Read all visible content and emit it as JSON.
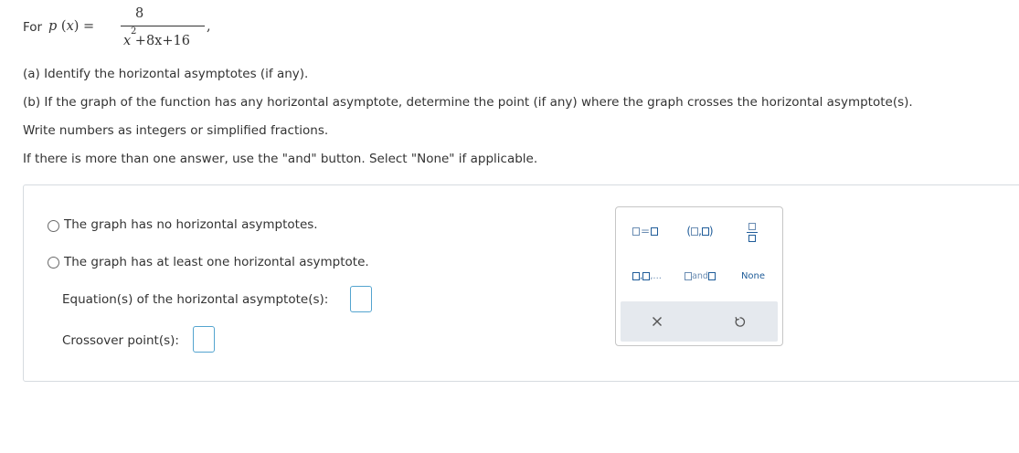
{
  "problem": {
    "lead": "For",
    "function_name": "p",
    "variable": "x",
    "numerator": "8",
    "denominator_rest": " +8x+16",
    "denominator_var": "x",
    "denominator_exp": "2",
    "trailing": ","
  },
  "instructions": {
    "part_a": "(a) Identify the horizontal asymptotes (if any).",
    "part_b": "(b) If the graph of the function has any horizontal asymptote, determine the point (if any) where the graph crosses the horizontal asymptote(s).",
    "format_note": "Write numbers as integers or simplified fractions.",
    "multi_note": "If there is more than one answer, use the \"and\" button. Select \"None\" if applicable."
  },
  "answer": {
    "option_none": "The graph has no horizontal asymptotes.",
    "option_some": "The graph has at least one horizontal asymptote.",
    "equation_label": "Equation(s) of the horizontal asymptote(s):",
    "crossover_label": "Crossover point(s):"
  },
  "keypad": {
    "equals": "=",
    "open_paren": "(",
    "comma": ",",
    "close_paren": ")",
    "ellipsis": ",...",
    "and_label": "and",
    "none_label": "None",
    "clear_icon": "close-x-icon",
    "undo_icon": "undo-arrow-icon"
  },
  "colors": {
    "keypad_blue": "#1f5c99",
    "input_border": "#54a4cf",
    "keypad_bar": "#e5e9ee"
  }
}
